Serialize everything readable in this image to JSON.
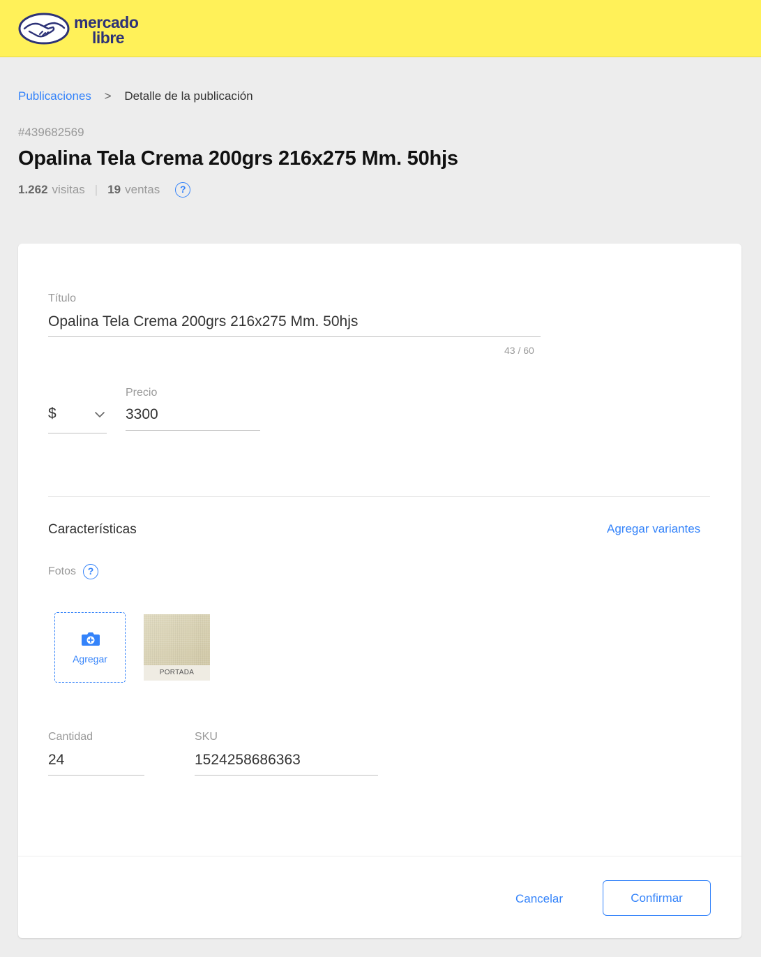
{
  "brand": {
    "name_line1": "mercado",
    "name_line2": "libre",
    "header_color": "#fff159",
    "accent": "#3483fa"
  },
  "breadcrumb": {
    "parent": "Publicaciones",
    "separator": ">",
    "current": "Detalle de la publicación"
  },
  "item": {
    "id": "#439682569",
    "title": "Opalina Tela Crema 200grs 216x275 Mm. 50hjs",
    "visits_count": "1.262",
    "visits_label": "visitas",
    "sales_count": "19",
    "sales_label": "ventas",
    "help_symbol": "?"
  },
  "form": {
    "title_label": "Título",
    "title_value": "Opalina Tela Crema 200grs 216x275 Mm. 50hjs",
    "title_counter": "43 / 60",
    "currency_value": "$",
    "price_label": "Precio",
    "price_value": "3300",
    "characteristics_label": "Características",
    "add_variants_label": "Agregar variantes",
    "photos_label": "Fotos",
    "add_photo_label": "Agregar",
    "cover_caption": "PORTADA",
    "quantity_label": "Cantidad",
    "quantity_value": "24",
    "sku_label": "SKU",
    "sku_value": "1524258686363"
  },
  "actions": {
    "cancel_label": "Cancelar",
    "confirm_label": "Confirmar"
  },
  "icons": {
    "logo": "handshake-logo-icon",
    "help": "question-circle-icon",
    "select": "chevron-down-icon",
    "add_photo": "camera-plus-icon"
  }
}
